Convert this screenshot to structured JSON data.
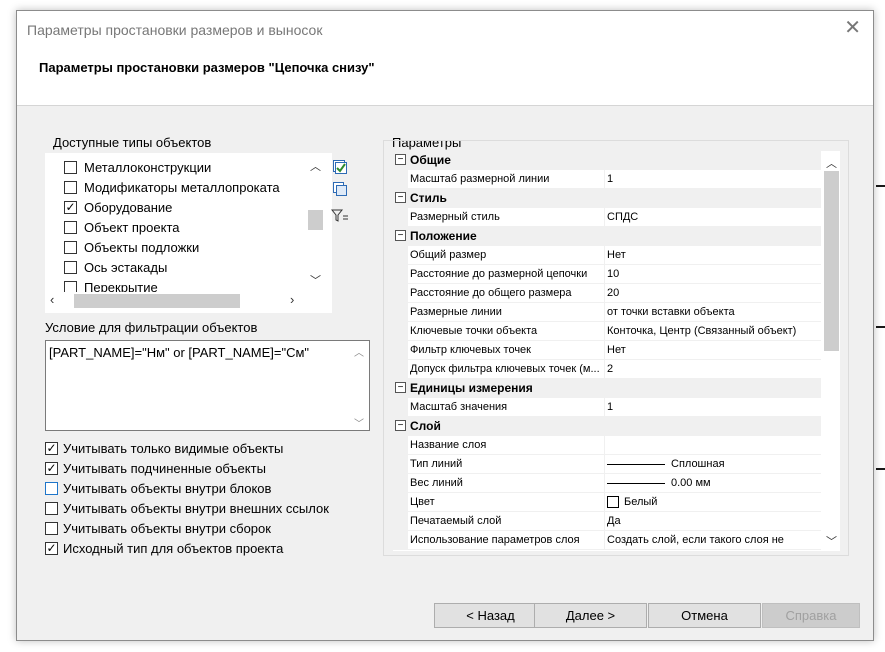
{
  "window": {
    "title": "Параметры простановки размеров и выносок",
    "close_symbol": "✕"
  },
  "header": {
    "heading": "Параметры простановки размеров \"Цепочка снизу\""
  },
  "object_types": {
    "label": "Доступные типы объектов",
    "items": [
      {
        "label": "Металлоконструкции",
        "checked": false
      },
      {
        "label": "Модификаторы металлопроката",
        "checked": false
      },
      {
        "label": "Оборудование",
        "checked": true
      },
      {
        "label": "Объект проекта",
        "checked": false
      },
      {
        "label": "Объекты подложки",
        "checked": false
      },
      {
        "label": "Ось эстакады",
        "checked": false
      },
      {
        "label": "Перекрытие",
        "checked": false
      }
    ],
    "icons": [
      "check-all-icon",
      "copy-icon",
      "filter-icon"
    ]
  },
  "filter": {
    "label": "Условие для фильтрации объектов",
    "value": "[PART_NAME]=\"Нм\" or [PART_NAME]=\"См\""
  },
  "options": [
    {
      "label": "Учитывать только видимые объекты",
      "checked": true
    },
    {
      "label": "Учитывать подчиненные объекты",
      "checked": true
    },
    {
      "label": "Учитывать объекты внутри блоков",
      "checked": false
    },
    {
      "label": "Учитывать объекты внутри внешних ссылок",
      "checked": false
    },
    {
      "label": "Учитывать объекты внутри сборок",
      "checked": false
    },
    {
      "label": "Исходный тип для объектов проекта",
      "checked": true
    }
  ],
  "params": {
    "label": "Параметры",
    "rows": [
      {
        "kind": "cat",
        "name": "Общие"
      },
      {
        "kind": "prop",
        "name": "Масштаб размерной линии",
        "value": "1"
      },
      {
        "kind": "cat",
        "name": "Стиль"
      },
      {
        "kind": "prop",
        "name": "Размерный стиль",
        "value": "СПДС"
      },
      {
        "kind": "cat",
        "name": "Положение"
      },
      {
        "kind": "prop",
        "name": "Общий размер",
        "value": "Нет"
      },
      {
        "kind": "prop",
        "name": "Расстояние до размерной цепочки",
        "value": "10"
      },
      {
        "kind": "prop",
        "name": "Расстояние до общего размера",
        "value": "20"
      },
      {
        "kind": "prop",
        "name": "Размерные линии",
        "value": "от точки вставки объекта"
      },
      {
        "kind": "prop",
        "name": "Ключевые точки объекта",
        "value": "Конточка, Центр (Связанный объект)"
      },
      {
        "kind": "prop",
        "name": "Фильтр ключевых точек",
        "value": "Нет"
      },
      {
        "kind": "prop",
        "name": "Допуск фильтра ключевых точек (м...",
        "value": "2"
      },
      {
        "kind": "cat",
        "name": "Единицы измерения"
      },
      {
        "kind": "prop",
        "name": "Масштаб значения",
        "value": "1"
      },
      {
        "kind": "cat",
        "name": "Слой"
      },
      {
        "kind": "prop",
        "name": "Название слоя",
        "value": ""
      },
      {
        "kind": "prop",
        "name": "Тип линий",
        "value": "Сплошная",
        "decor": "line"
      },
      {
        "kind": "prop",
        "name": "Вес линий",
        "value": "0.00 мм",
        "decor": "line"
      },
      {
        "kind": "prop",
        "name": "Цвет",
        "value": "Белый",
        "decor": "color"
      },
      {
        "kind": "prop",
        "name": "Печатаемый слой",
        "value": "Да"
      },
      {
        "kind": "prop",
        "name": "Использование параметров слоя",
        "value": "Создать слой, если такого слоя не"
      }
    ]
  },
  "buttons": {
    "back": "< Назад",
    "next": "Далее >",
    "cancel": "Отмена",
    "help": "Справка"
  }
}
